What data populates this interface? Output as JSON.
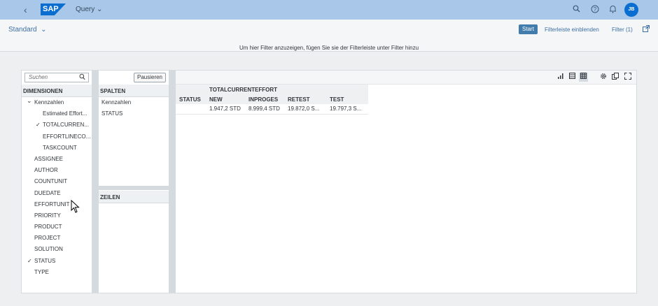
{
  "shell": {
    "title": "Query",
    "logo_text": "SAP",
    "avatar_initials": "JB"
  },
  "variant": {
    "label": "Standard"
  },
  "toolbar": {
    "start_label": "Start",
    "filterbar_label": "Filterleiste einblenden",
    "filter_label": "Filter (1)"
  },
  "hint": "Um hier Filter anzuzeigen, fügen Sie sie der Filterleiste unter Filter hinzu",
  "dimensions": {
    "search_placeholder": "Suchen",
    "header": "DIMENSIONEN",
    "items": [
      {
        "label": "Kennzahlen"
      },
      {
        "label": "Estimated Effort..."
      },
      {
        "label": "TOTALCURREN..."
      },
      {
        "label": "EFFORTLINECO..."
      },
      {
        "label": "TASKCOUNT"
      },
      {
        "label": "ASSIGNEE"
      },
      {
        "label": "AUTHOR"
      },
      {
        "label": "COUNTUNIT"
      },
      {
        "label": "DUEDATE"
      },
      {
        "label": "EFFORTUNIT"
      },
      {
        "label": "PRIORITY"
      },
      {
        "label": "PRODUCT"
      },
      {
        "label": "PROJECT"
      },
      {
        "label": "SOLUTION"
      },
      {
        "label": "STATUS"
      },
      {
        "label": "TYPE"
      }
    ]
  },
  "layout_panel": {
    "pause_label": "Pausieren",
    "columns_header": "SPALTEN",
    "columns": [
      "Kennzahlen",
      "STATUS"
    ],
    "rows_header": "ZEILEN"
  },
  "pivot": {
    "measure": "TOTALCURRENTEFFORT",
    "row_header": "STATUS",
    "columns": [
      "NEW",
      "INPROGES",
      "RETEST",
      "TEST"
    ],
    "values": [
      "1.947,2 STD",
      "8.999,4 STD",
      "19.872,0 S...",
      "19.797,3 S..."
    ]
  }
}
